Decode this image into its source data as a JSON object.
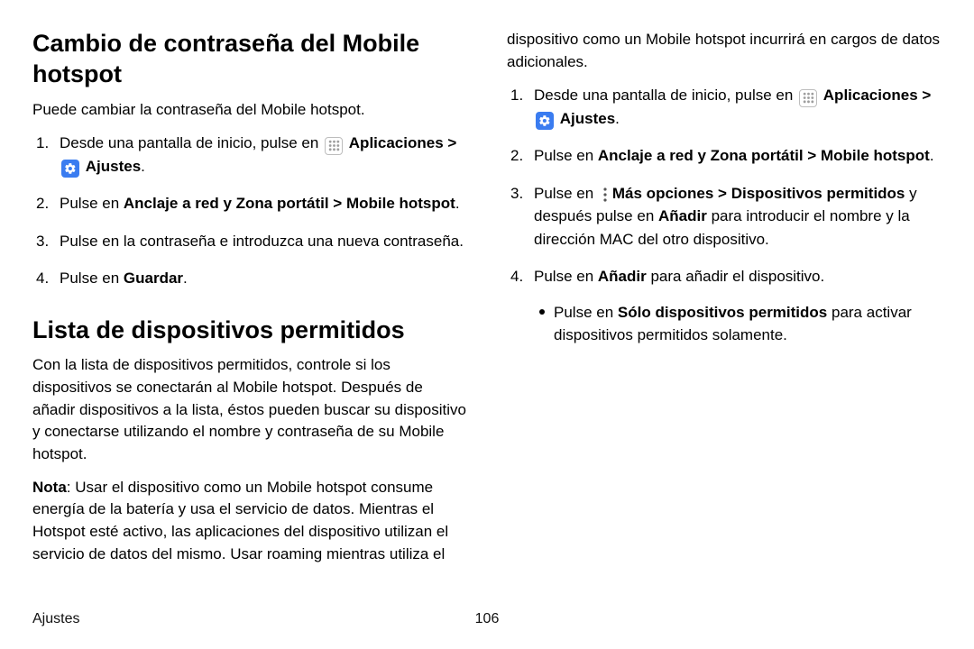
{
  "section1": {
    "heading": "Cambio de contraseña del Mobile hotspot",
    "lead": "Puede cambiar la contraseña del Mobile hotspot.",
    "step1_a": "Desde una pantalla de inicio, pulse en ",
    "apps": "Aplicaciones",
    "sep": " > ",
    "settings": "Ajustes",
    "period": ".",
    "step2_a": "Pulse en ",
    "step2_b": "Anclaje a red y Zona portátil",
    "step2_c": "Mobile hotspot",
    "step3": "Pulse en la contraseña e introduzca una nueva contraseña.",
    "step4_a": "Pulse en ",
    "step4_b": "Guardar"
  },
  "section2": {
    "heading": "Lista de dispositivos permitidos",
    "lead": "Con la lista de dispositivos permitidos, controle si los dispositivos se conectarán al Mobile hotspot. Después de añadir dispositivos a la lista, éstos pueden buscar su dispositivo y conectarse utilizando el nombre y contraseña de su Mobile hotspot.",
    "note_label": "Nota",
    "note_body": ": Usar el dispositivo como un Mobile hotspot consume energía de la batería y usa el servicio de datos. Mientras el Hotspot esté activo, las aplicaciones del dispositivo utilizan el servicio de datos del mismo. Usar roaming mientras utiliza el dispositivo como un Mobile hotspot incurrirá en cargos de datos adicionales.",
    "step1_a": "Desde una pantalla de inicio, pulse en ",
    "step2_a": "Pulse en ",
    "step2_b": "Anclaje a red y Zona portátil",
    "step2_c": "Mobile hotspot",
    "step3_a": "Pulse en ",
    "step3_b": "Más opciones",
    "step3_c": "Dispositivos permitidos",
    "step3_d": " y después pulse en ",
    "step3_e": "Añadir",
    "step3_f": " para introducir el nombre y la dirección MAC del otro dispositivo.",
    "step4_a": "Pulse en ",
    "step4_b": "Añadir",
    "step4_c": " para añadir el dispositivo.",
    "bullet_a": "Pulse en ",
    "bullet_b": "Sólo dispositivos permitidos",
    "bullet_c": " para activar dispositivos permitidos solamente."
  },
  "footer": {
    "section": "Ajustes",
    "page": "106"
  }
}
